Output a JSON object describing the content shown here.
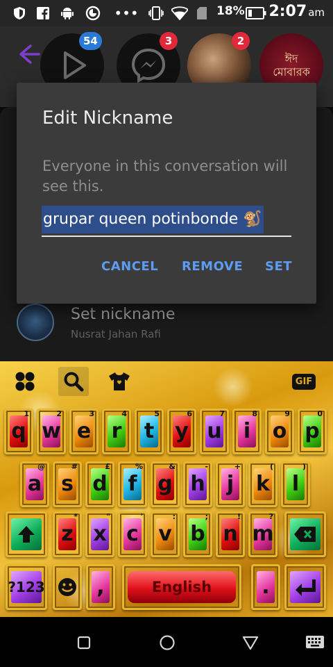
{
  "status_bar": {
    "battery": "18%",
    "time": "2:07",
    "ampm": "am",
    "icons": [
      "shield-icon",
      "facebook-icon",
      "android-icon",
      "data-saver-icon",
      "more-dots-icon",
      "vibrate-icon",
      "wifi-icon",
      "sim-icon",
      "battery-icon"
    ]
  },
  "background": {
    "badges": [
      "54",
      "3",
      "2"
    ],
    "app_tile_label": "ঈদ মোবারক",
    "row_title": "Set nickname",
    "row_subtitle": "Nusrat Jahan Rafi"
  },
  "dialog": {
    "title": "Edit Nickname",
    "message": "Everyone in this conversation will see this.",
    "input_value": "grupar queen potinbonde 🐒",
    "cancel": "CANCEL",
    "remove": "REMOVE",
    "set": "SET"
  },
  "keyboard": {
    "toolbar": [
      "apps-icon",
      "search-icon",
      "shirt-icon",
      "gif-icon"
    ],
    "gif_label": "GIF",
    "row1": [
      {
        "k": "q",
        "h": "1"
      },
      {
        "k": "w",
        "h": "2"
      },
      {
        "k": "e",
        "h": "3"
      },
      {
        "k": "r",
        "h": "4"
      },
      {
        "k": "t",
        "h": "5"
      },
      {
        "k": "y",
        "h": "6"
      },
      {
        "k": "u",
        "h": "7"
      },
      {
        "k": "i",
        "h": "8"
      },
      {
        "k": "o",
        "h": "9"
      },
      {
        "k": "p",
        "h": "0"
      }
    ],
    "row2": [
      {
        "k": "a",
        "h": "@"
      },
      {
        "k": "s",
        "h": "#"
      },
      {
        "k": "d",
        "h": "£"
      },
      {
        "k": "f",
        "h": "%"
      },
      {
        "k": "g",
        "h": "&"
      },
      {
        "k": "h",
        "h": "-"
      },
      {
        "k": "j",
        "h": "+"
      },
      {
        "k": "k",
        "h": "("
      },
      {
        "k": "l",
        "h": ")"
      }
    ],
    "row3": [
      {
        "k": "z",
        "h": "*"
      },
      {
        "k": "x",
        "h": "\""
      },
      {
        "k": "c",
        "h": "'"
      },
      {
        "k": "v",
        "h": ":"
      },
      {
        "k": "b",
        "h": ";"
      },
      {
        "k": "n",
        "h": "!"
      },
      {
        "k": "m",
        "h": "?"
      }
    ],
    "symbols": "?123",
    "comma": ",",
    "space": "English",
    "period": "."
  },
  "colors": {
    "accent_blue": "#5d9cf0",
    "dialog_bg": "#3b3b3b",
    "badge_blue": "#2b7bd6",
    "badge_red": "#e0293a",
    "messenger_purple": "#7b3fc9"
  }
}
